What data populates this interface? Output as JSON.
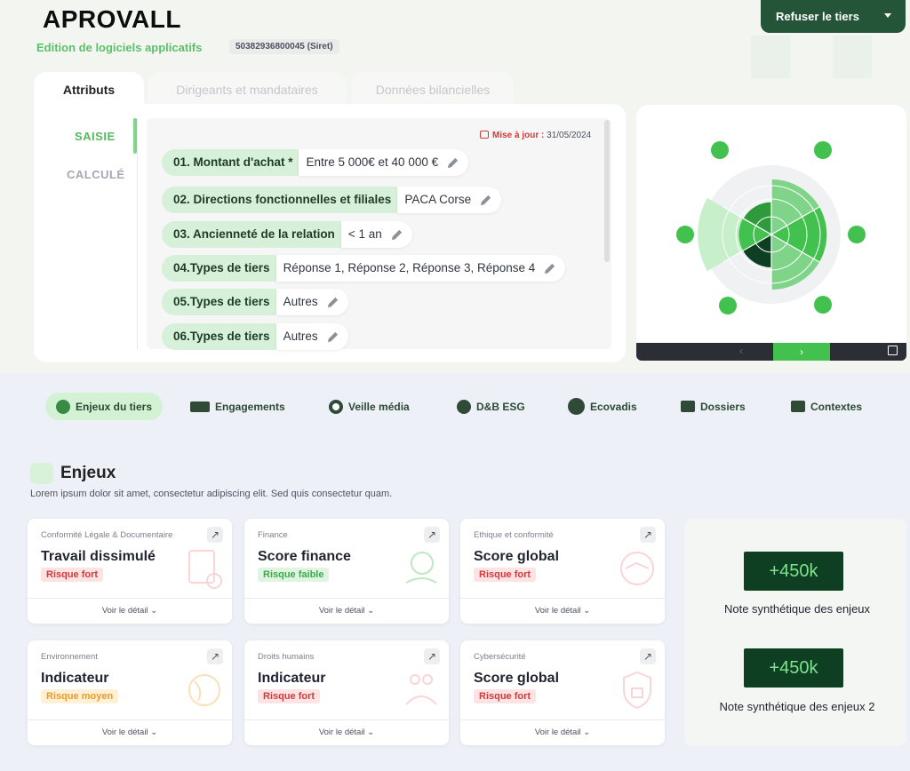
{
  "header": {
    "company": "APROVALL",
    "sector": "Edition de logiciels applicatifs",
    "siret": "50382936800045 (Siret)",
    "refuse_button": "Refuser le tiers"
  },
  "tabs": [
    {
      "label": "Attributs"
    },
    {
      "label": "Dirigeants et mandataires"
    },
    {
      "label": "Données bilancielles"
    }
  ],
  "side_menu": {
    "saisie": "SAISIE",
    "calcule": "CALCULÉ"
  },
  "update": {
    "label": "Mise à jour :",
    "date": "31/05/2024"
  },
  "fields": [
    {
      "key": "01. Montant d'achat *",
      "value": "Entre 5 000€ et 40 000 €"
    },
    {
      "key": "02. Directions fonctionnelles et filiales",
      "value": "PACA Corse"
    },
    {
      "key": "03. Ancienneté de la relation",
      "value": "< 1 an"
    },
    {
      "key": "04.Types de tiers",
      "value": "Réponse 1, Réponse 2, Réponse 3, Réponse 4"
    },
    {
      "key": "05.Types de tiers",
      "value": "Autres"
    },
    {
      "key": "06.Types de tiers",
      "value": "Autres"
    }
  ],
  "radar_nav": {
    "prev": "‹",
    "next": "›"
  },
  "nav_tabs": [
    {
      "label": "Enjeux du tiers",
      "icon": "recycle-icon"
    },
    {
      "label": "Engagements",
      "icon": "handshake-icon"
    },
    {
      "label": "Veille média",
      "icon": "target-icon"
    },
    {
      "label": "D&B ESG",
      "icon": "db-icon"
    },
    {
      "label": "Ecovadis",
      "icon": "ecovadis-icon"
    },
    {
      "label": "Dossiers",
      "icon": "folder-icon"
    },
    {
      "label": "Contextes",
      "icon": "briefcase-icon"
    }
  ],
  "section": {
    "title": "Enjeux",
    "description": "Lorem ipsum dolor sit amet, consectetur adipiscing elit. Sed quis consectetur quam."
  },
  "cards": [
    {
      "category": "Conformité Légale & Documentaire",
      "title": "Travail dissimulé",
      "risk": "Risque fort",
      "detail": "Voir le détail"
    },
    {
      "category": "Finance",
      "title": "Score finance",
      "risk": "Risque faible",
      "detail": "Voir le détail"
    },
    {
      "category": "Ethique et conformité",
      "title": "Score global",
      "risk": "Risque fort",
      "detail": "Voir le détail"
    },
    {
      "category": "Environnement",
      "title": "Indicateur",
      "risk": "Risque moyen",
      "detail": "Voir le détail"
    },
    {
      "category": "Droits humains",
      "title": "Indicateur",
      "risk": "Risque fort",
      "detail": "Voir le détail"
    },
    {
      "category": "Cybersécurité",
      "title": "Score global",
      "risk": "Risque fort",
      "detail": "Voir le détail"
    }
  ],
  "summary": [
    {
      "value": "+450k",
      "label": "Note synthétique des enjeux"
    },
    {
      "value": "+450k",
      "label": "Note synthétique des enjeux 2"
    }
  ],
  "colors": {
    "brand_dark": "#245538",
    "accent_green": "#43c14e",
    "risk_red": "#d23a3a",
    "risk_green": "#3eaa4c",
    "risk_orange": "#eb9b25"
  }
}
